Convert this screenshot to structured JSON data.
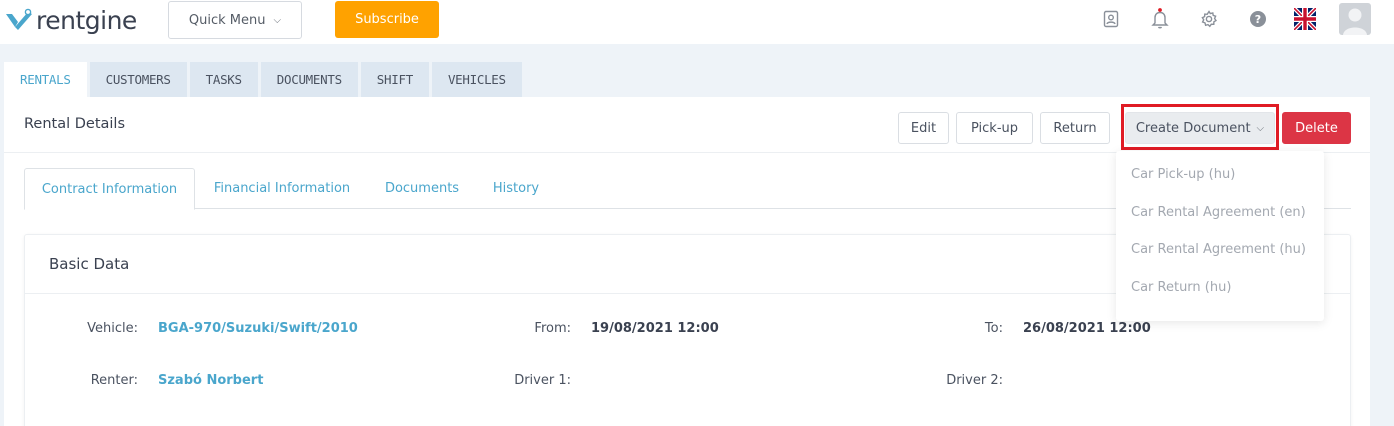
{
  "app": {
    "logo_text": "rentgine",
    "quick_menu_label": "Quick Menu",
    "subscribe_label": "Subscribe",
    "icons": [
      "contacts-icon",
      "bell-icon",
      "gear-icon",
      "help-icon",
      "uk-flag-icon",
      "user-avatar-icon"
    ],
    "colors": {
      "accent": "#4aa6cc",
      "subscribe": "#ffa200",
      "delete": "#dc3545",
      "highlight": "#e01b24"
    }
  },
  "module_tabs": [
    {
      "label": "RENTALS",
      "active": true
    },
    {
      "label": "CUSTOMERS",
      "active": false
    },
    {
      "label": "TASKS",
      "active": false
    },
    {
      "label": "DOCUMENTS",
      "active": false
    },
    {
      "label": "SHIFT",
      "active": false
    },
    {
      "label": "VEHICLES",
      "active": false
    }
  ],
  "details": {
    "title": "Rental Details",
    "actions": {
      "edit": "Edit",
      "pickup": "Pick-up",
      "return": "Return",
      "create_document": "Create Document",
      "delete": "Delete"
    }
  },
  "inner_tabs": [
    {
      "label": "Contract Information",
      "active": true
    },
    {
      "label": "Financial Information",
      "active": false
    },
    {
      "label": "Documents",
      "active": false
    },
    {
      "label": "History",
      "active": false
    }
  ],
  "basic_data": {
    "title": "Basic Data",
    "vehicle_label": "Vehicle:",
    "vehicle_value": "BGA-970/Suzuki/Swift/2010",
    "from_label": "From:",
    "from_value": "19/08/2021 12:00",
    "to_label": "To:",
    "to_value": "26/08/2021 12:00",
    "renter_label": "Renter:",
    "renter_value": "Szabó Norbert",
    "driver1_label": "Driver 1:",
    "driver2_label": "Driver 2:"
  },
  "create_document_menu": [
    "Car Pick-up (hu)",
    "Car Rental Agreement (en)",
    "Car Rental Agreement (hu)",
    "Car Return (hu)"
  ]
}
